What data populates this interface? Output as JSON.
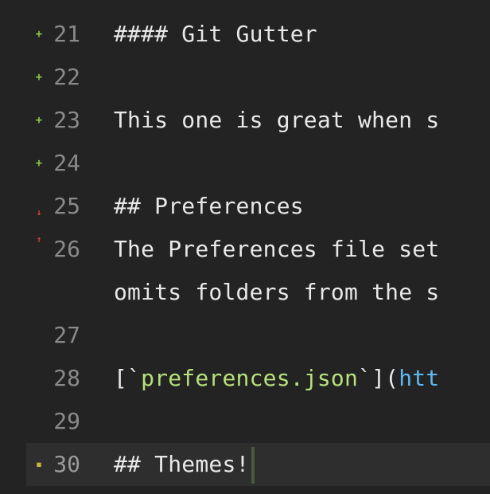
{
  "editor": {
    "lines": [
      {
        "num": "21",
        "mark": "+",
        "text": "#### Git Gutter"
      },
      {
        "num": "22",
        "mark": "+",
        "text": ""
      },
      {
        "num": "23",
        "mark": "+",
        "text": "This one is great when s"
      },
      {
        "num": "24",
        "mark": "+",
        "text": ""
      },
      {
        "num": "25",
        "mark": "↓",
        "text": "## Preferences"
      },
      {
        "num": "26",
        "mark": "↑",
        "text": "The Preferences file set",
        "wrap": "omits folders from the s"
      },
      {
        "num": "27",
        "mark": "",
        "text": ""
      },
      {
        "num": "28",
        "mark": "",
        "text_open": "[`",
        "text_str": "preferences.json",
        "text_close": "`](",
        "text_link": "htt"
      },
      {
        "num": "29",
        "mark": "",
        "text": ""
      },
      {
        "num": "30",
        "mark": "▪",
        "text": "## Themes!"
      }
    ]
  },
  "colors": {
    "background": "#232323",
    "added": "#8bc34a",
    "deleted": "#e0443a",
    "modified": "#c8b43a",
    "string": "#b7e17a",
    "link": "#5fb8ef"
  }
}
